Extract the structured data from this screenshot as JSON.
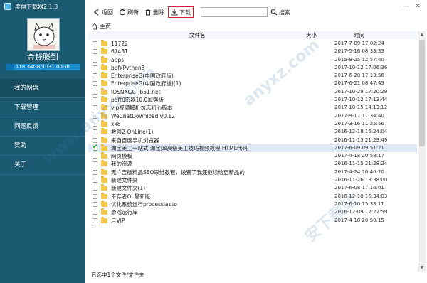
{
  "app": {
    "title": "度盘下载器2.1.3"
  },
  "user": {
    "name": "金钱滕到",
    "quota": "118.34GB/1031.00GB",
    "quota_fraction": 0.115
  },
  "nav": [
    {
      "label": "我的网盘",
      "active": true
    },
    {
      "label": "下载管理",
      "active": false
    },
    {
      "label": "问题反馈",
      "active": false
    },
    {
      "label": "赞助",
      "active": false
    },
    {
      "label": "关于",
      "active": false
    }
  ],
  "toolbar": {
    "back_label": "返回",
    "refresh_label": "刷新",
    "delete_label": "删除",
    "download_label": "下载",
    "search_value": "",
    "search_label": "搜索"
  },
  "breadcrumb": {
    "home_label": "主页"
  },
  "columns": {
    "name": "文件名",
    "size": "大小",
    "time": "时间"
  },
  "files": [
    {
      "name": "11722",
      "time": "2017-7-09 17:02:24",
      "checked": false
    },
    {
      "name": "67431",
      "time": "2017-5-16 08:33:33",
      "checked": false
    },
    {
      "name": "apps",
      "time": "2015-8-25 12:57:40",
      "checked": false
    },
    {
      "name": "bbfxPython3",
      "time": "2017-10-12 17:06:36",
      "checked": false
    },
    {
      "name": "EnterpriseG(中国政府版)",
      "time": "2017-6-20 17:13:56",
      "checked": false
    },
    {
      "name": "EnterpriseG(中国政府版)(1)",
      "time": "2017-6-21 08:47:43",
      "checked": false
    },
    {
      "name": "IOSNXGC_jb51.net",
      "time": "2017-10-29 17:20:29",
      "checked": false
    },
    {
      "name": "pdf加密器10.0加强版",
      "time": "2017-10-12 17:13:44",
      "checked": false
    },
    {
      "name": "vip视频解析勿忘初心版本",
      "time": "2017-10-15 14:13:12",
      "checked": false
    },
    {
      "name": "WeChatDownload v0.12",
      "time": "2017-9-17 17:34:40",
      "checked": false
    },
    {
      "name": "xx8",
      "time": "2017-3-16 11:25:56",
      "checked": false
    },
    {
      "name": "救赎2-OnLine(1)",
      "time": "2016-12-18 16:24:04",
      "checked": false
    },
    {
      "name": "来自百度手机浏览器",
      "time": "2016-11-15 21:29:49",
      "checked": false
    },
    {
      "name": "淘宝美工一站式 淘宝ps高级美工技巧视频教程 HTML代码",
      "time": "2017-6-09 09:51:21",
      "checked": true
    },
    {
      "name": "网页模板",
      "time": "2017-4-18 20:58:17",
      "checked": false
    },
    {
      "name": "我的资源",
      "time": "2016-11-15 21:28:24",
      "checked": false
    },
    {
      "name": "无广告版精品SEO思维教程，设置了我还继续给更精品的",
      "time": "2017-4-24 20:40:20",
      "checked": false
    },
    {
      "name": "新建文件夹",
      "time": "2016-11-26 13:38:00",
      "checked": false
    },
    {
      "name": "新建文件夹(1)",
      "time": "2017-6-08 17:16:01",
      "checked": false
    },
    {
      "name": "幸存者OL最新版",
      "time": "2016-12-18 16:34:03",
      "checked": false
    },
    {
      "name": "优化系统运行processlasso",
      "time": "2017-6-10 15:33:11",
      "checked": false
    },
    {
      "name": "游戏运行库",
      "time": "2016-12-09 12:22:59",
      "checked": false
    },
    {
      "name": "月VIP",
      "time": "2017-4-18 20:50:15",
      "checked": false
    }
  ],
  "status": {
    "text": "已选中1个文件/文件夹"
  },
  "colors": {
    "sidebar": "#1c5a72",
    "accent": "#1a8fd1",
    "selected_row": "#dfe9f6",
    "download_highlight": "#d0202a"
  },
  "icons": [
    "back-icon",
    "refresh-icon",
    "delete-icon",
    "download-icon",
    "search-icon",
    "home-icon",
    "folder-icon",
    "minimize-icon",
    "close-icon"
  ]
}
